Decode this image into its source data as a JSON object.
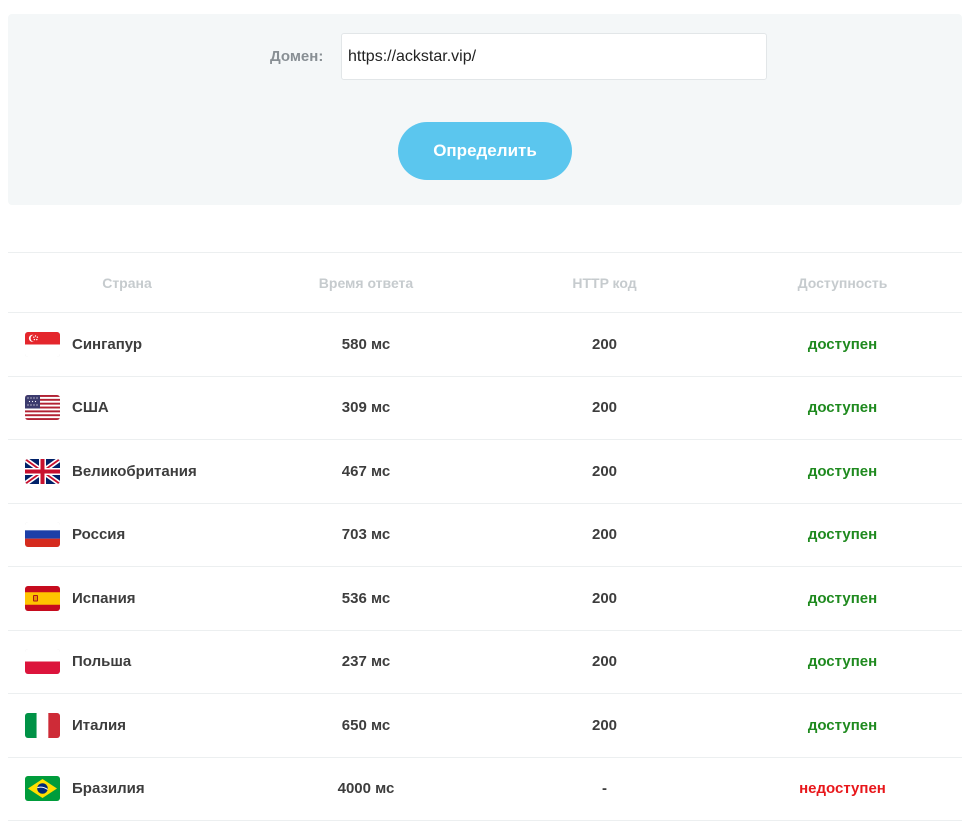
{
  "form": {
    "domain_label": "Домен:",
    "domain_value": "https://ackstar.vip/",
    "submit_label": "Определить"
  },
  "table": {
    "headers": {
      "country": "Страна",
      "response_time": "Время ответа",
      "http_code": "HTTP код",
      "availability": "Доступность"
    },
    "rows": [
      {
        "country": "Сингапур",
        "flag": "singapore-flag-icon",
        "time": "580 мс",
        "code": "200",
        "status": "доступен",
        "ok": true
      },
      {
        "country": "США",
        "flag": "usa-flag-icon",
        "time": "309 мс",
        "code": "200",
        "status": "доступен",
        "ok": true
      },
      {
        "country": "Великобритания",
        "flag": "uk-flag-icon",
        "time": "467 мс",
        "code": "200",
        "status": "доступен",
        "ok": true
      },
      {
        "country": "Россия",
        "flag": "russia-flag-icon",
        "time": "703 мс",
        "code": "200",
        "status": "доступен",
        "ok": true
      },
      {
        "country": "Испания",
        "flag": "spain-flag-icon",
        "time": "536 мс",
        "code": "200",
        "status": "доступен",
        "ok": true
      },
      {
        "country": "Польша",
        "flag": "poland-flag-icon",
        "time": "237 мс",
        "code": "200",
        "status": "доступен",
        "ok": true
      },
      {
        "country": "Италия",
        "flag": "italy-flag-icon",
        "time": "650 мс",
        "code": "200",
        "status": "доступен",
        "ok": true
      },
      {
        "country": "Бразилия",
        "flag": "brazil-flag-icon",
        "time": "4000 мс",
        "code": "-",
        "status": "недоступен",
        "ok": false
      }
    ]
  },
  "colors": {
    "accent": "#5bc6ee",
    "available": "#1f8a1f",
    "unavailable": "#e8171b",
    "panel_bg": "#f4f7f8"
  }
}
